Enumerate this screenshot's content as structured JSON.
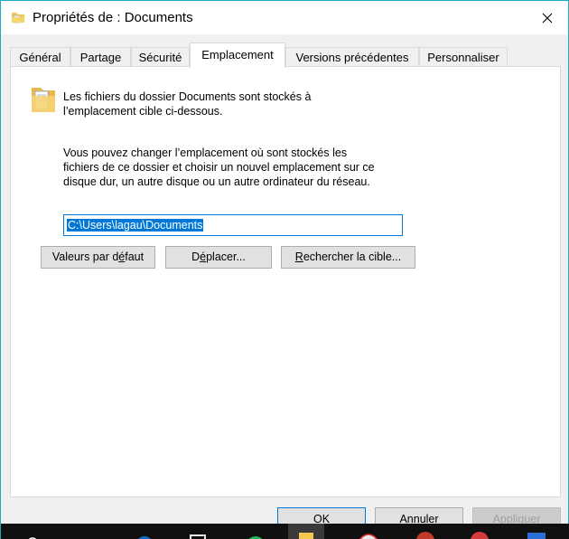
{
  "window": {
    "title": "Propriétés de : Documents",
    "accent": "#1aa9c7"
  },
  "tabs": [
    {
      "label": "Général"
    },
    {
      "label": "Partage"
    },
    {
      "label": "Sécurité"
    },
    {
      "label": "Emplacement",
      "active": true
    },
    {
      "label": "Versions précédentes"
    },
    {
      "label": "Personnaliser"
    }
  ],
  "panel": {
    "info_line1": "Les fichiers du dossier Documents sont stockés à",
    "info_line2": "l’emplacement cible ci-dessous.",
    "desc_line1": "Vous pouvez changer l’emplacement où sont stockés les",
    "desc_line2": "fichiers de ce dossier et choisir un nouvel emplacement sur ce",
    "desc_line3": "disque dur, un autre disque ou un autre ordinateur du réseau.",
    "path_value": "C:\\Users\\lagau\\Documents",
    "btn_default_pre": "Valeurs par d",
    "btn_default_u": "é",
    "btn_default_post": "faut",
    "btn_move_pre": "D",
    "btn_move_u": "é",
    "btn_move_post": "placer...",
    "btn_find_pre": "",
    "btn_find_u": "R",
    "btn_find_post": "echercher la cible..."
  },
  "footer": {
    "ok": "OK",
    "cancel": "Annuler",
    "apply": "Appliquer"
  }
}
